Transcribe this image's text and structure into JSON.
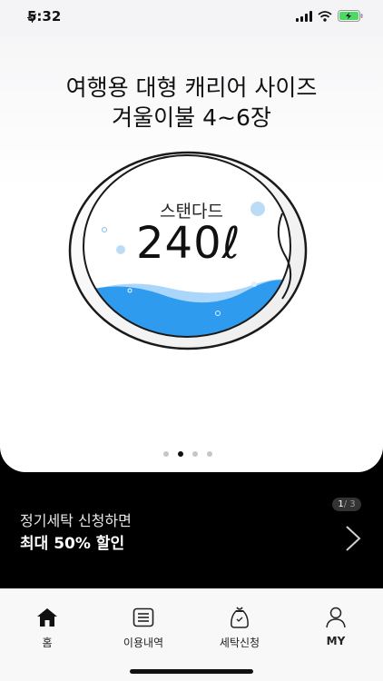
{
  "status": {
    "time": "5:32"
  },
  "hero": {
    "title_line1": "여행용 대형 캐리어 사이즈",
    "title_line2": "겨울이불 4~6장"
  },
  "drum": {
    "label": "스탠다드",
    "capacity": "240ℓ"
  },
  "carousel": {
    "slides": 4,
    "active_index": 1
  },
  "promo": {
    "line1": "정기세탁 신청하면",
    "line2": "최대 50% 할인",
    "pager_current": "1",
    "pager_total": "/ 3"
  },
  "tabs": [
    {
      "label": "홈",
      "icon": "home-icon"
    },
    {
      "label": "이용내역",
      "icon": "list-icon"
    },
    {
      "label": "세탁신청",
      "icon": "laundry-bag-icon"
    },
    {
      "label": "MY",
      "icon": "person-icon"
    }
  ],
  "colors": {
    "water": "#2f9bef",
    "water_light": "#a9d6fa",
    "background_dark": "#000000"
  }
}
